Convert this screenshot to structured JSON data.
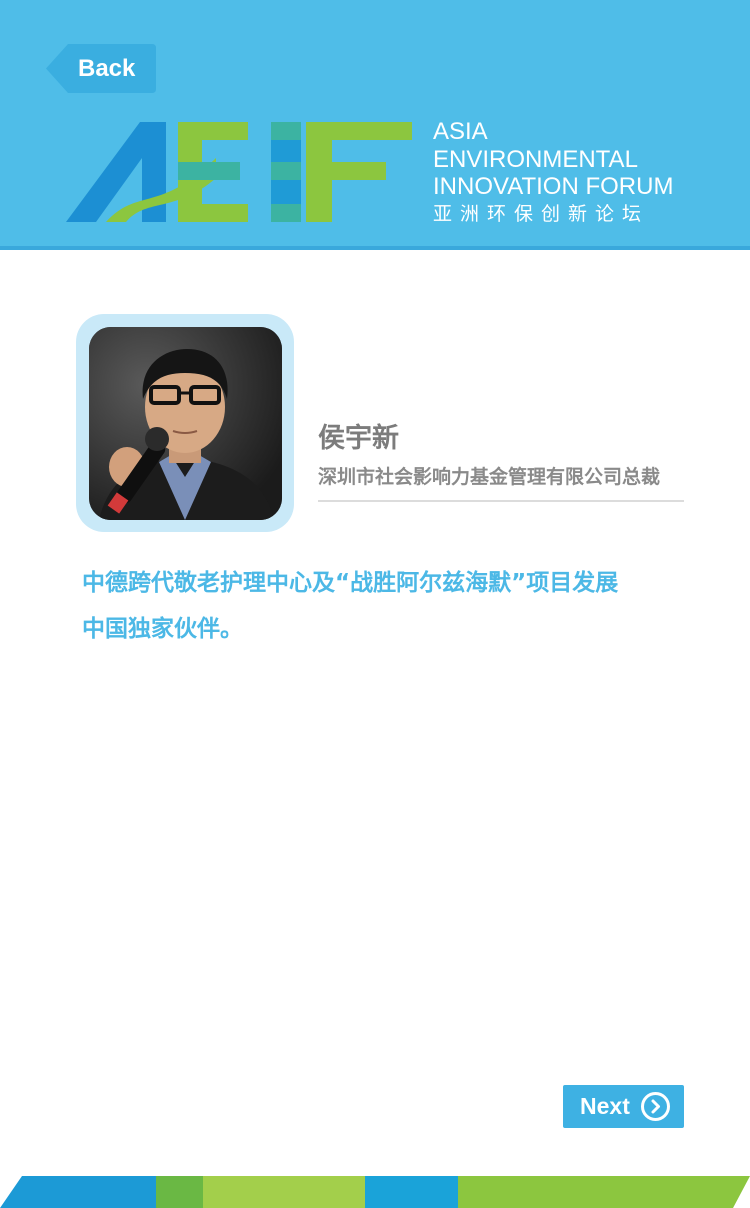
{
  "header": {
    "back_label": "Back",
    "logo": {
      "mark": "AEIF",
      "line1": "ASIA",
      "line2": "ENVIRONMENTAL",
      "line3": "INNOVATION FORUM",
      "chinese": "亚洲环保创新论坛"
    }
  },
  "profile": {
    "name": "侯宇新",
    "title": "深圳市社会影响力基金管理有限公司总裁",
    "description_lines": [
      "中德跨代敬老护理中心及“战胜阿尔兹海默”项目发展",
      "中国独家伙伴。"
    ]
  },
  "footer": {
    "next_label": "Next"
  },
  "colors": {
    "header_bg": "#4fbde8",
    "accent_blue": "#4cb8e6",
    "button_blue": "#3eb1e3",
    "accent_green": "#8cc63f",
    "text_gray": "#7c7c7c"
  },
  "icons": {
    "back": "back-arrow-tab",
    "next": "chevron-right-circle-icon"
  }
}
